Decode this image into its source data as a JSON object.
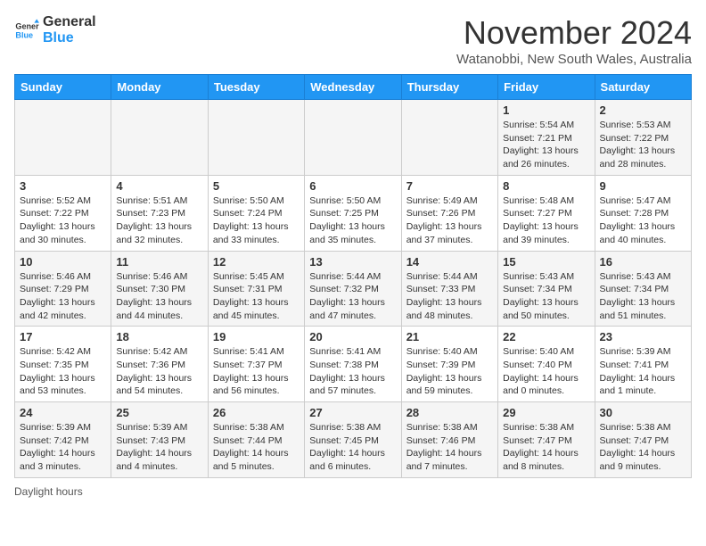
{
  "logo": {
    "line1": "General",
    "line2": "Blue"
  },
  "title": "November 2024",
  "subtitle": "Watanobbi, New South Wales, Australia",
  "headers": [
    "Sunday",
    "Monday",
    "Tuesday",
    "Wednesday",
    "Thursday",
    "Friday",
    "Saturday"
  ],
  "weeks": [
    [
      {
        "day": "",
        "info": ""
      },
      {
        "day": "",
        "info": ""
      },
      {
        "day": "",
        "info": ""
      },
      {
        "day": "",
        "info": ""
      },
      {
        "day": "",
        "info": ""
      },
      {
        "day": "1",
        "info": "Sunrise: 5:54 AM\nSunset: 7:21 PM\nDaylight: 13 hours and 26 minutes."
      },
      {
        "day": "2",
        "info": "Sunrise: 5:53 AM\nSunset: 7:22 PM\nDaylight: 13 hours and 28 minutes."
      }
    ],
    [
      {
        "day": "3",
        "info": "Sunrise: 5:52 AM\nSunset: 7:22 PM\nDaylight: 13 hours and 30 minutes."
      },
      {
        "day": "4",
        "info": "Sunrise: 5:51 AM\nSunset: 7:23 PM\nDaylight: 13 hours and 32 minutes."
      },
      {
        "day": "5",
        "info": "Sunrise: 5:50 AM\nSunset: 7:24 PM\nDaylight: 13 hours and 33 minutes."
      },
      {
        "day": "6",
        "info": "Sunrise: 5:50 AM\nSunset: 7:25 PM\nDaylight: 13 hours and 35 minutes."
      },
      {
        "day": "7",
        "info": "Sunrise: 5:49 AM\nSunset: 7:26 PM\nDaylight: 13 hours and 37 minutes."
      },
      {
        "day": "8",
        "info": "Sunrise: 5:48 AM\nSunset: 7:27 PM\nDaylight: 13 hours and 39 minutes."
      },
      {
        "day": "9",
        "info": "Sunrise: 5:47 AM\nSunset: 7:28 PM\nDaylight: 13 hours and 40 minutes."
      }
    ],
    [
      {
        "day": "10",
        "info": "Sunrise: 5:46 AM\nSunset: 7:29 PM\nDaylight: 13 hours and 42 minutes."
      },
      {
        "day": "11",
        "info": "Sunrise: 5:46 AM\nSunset: 7:30 PM\nDaylight: 13 hours and 44 minutes."
      },
      {
        "day": "12",
        "info": "Sunrise: 5:45 AM\nSunset: 7:31 PM\nDaylight: 13 hours and 45 minutes."
      },
      {
        "day": "13",
        "info": "Sunrise: 5:44 AM\nSunset: 7:32 PM\nDaylight: 13 hours and 47 minutes."
      },
      {
        "day": "14",
        "info": "Sunrise: 5:44 AM\nSunset: 7:33 PM\nDaylight: 13 hours and 48 minutes."
      },
      {
        "day": "15",
        "info": "Sunrise: 5:43 AM\nSunset: 7:34 PM\nDaylight: 13 hours and 50 minutes."
      },
      {
        "day": "16",
        "info": "Sunrise: 5:43 AM\nSunset: 7:34 PM\nDaylight: 13 hours and 51 minutes."
      }
    ],
    [
      {
        "day": "17",
        "info": "Sunrise: 5:42 AM\nSunset: 7:35 PM\nDaylight: 13 hours and 53 minutes."
      },
      {
        "day": "18",
        "info": "Sunrise: 5:42 AM\nSunset: 7:36 PM\nDaylight: 13 hours and 54 minutes."
      },
      {
        "day": "19",
        "info": "Sunrise: 5:41 AM\nSunset: 7:37 PM\nDaylight: 13 hours and 56 minutes."
      },
      {
        "day": "20",
        "info": "Sunrise: 5:41 AM\nSunset: 7:38 PM\nDaylight: 13 hours and 57 minutes."
      },
      {
        "day": "21",
        "info": "Sunrise: 5:40 AM\nSunset: 7:39 PM\nDaylight: 13 hours and 59 minutes."
      },
      {
        "day": "22",
        "info": "Sunrise: 5:40 AM\nSunset: 7:40 PM\nDaylight: 14 hours and 0 minutes."
      },
      {
        "day": "23",
        "info": "Sunrise: 5:39 AM\nSunset: 7:41 PM\nDaylight: 14 hours and 1 minute."
      }
    ],
    [
      {
        "day": "24",
        "info": "Sunrise: 5:39 AM\nSunset: 7:42 PM\nDaylight: 14 hours and 3 minutes."
      },
      {
        "day": "25",
        "info": "Sunrise: 5:39 AM\nSunset: 7:43 PM\nDaylight: 14 hours and 4 minutes."
      },
      {
        "day": "26",
        "info": "Sunrise: 5:38 AM\nSunset: 7:44 PM\nDaylight: 14 hours and 5 minutes."
      },
      {
        "day": "27",
        "info": "Sunrise: 5:38 AM\nSunset: 7:45 PM\nDaylight: 14 hours and 6 minutes."
      },
      {
        "day": "28",
        "info": "Sunrise: 5:38 AM\nSunset: 7:46 PM\nDaylight: 14 hours and 7 minutes."
      },
      {
        "day": "29",
        "info": "Sunrise: 5:38 AM\nSunset: 7:47 PM\nDaylight: 14 hours and 8 minutes."
      },
      {
        "day": "30",
        "info": "Sunrise: 5:38 AM\nSunset: 7:47 PM\nDaylight: 14 hours and 9 minutes."
      }
    ]
  ],
  "legend": "Daylight hours"
}
